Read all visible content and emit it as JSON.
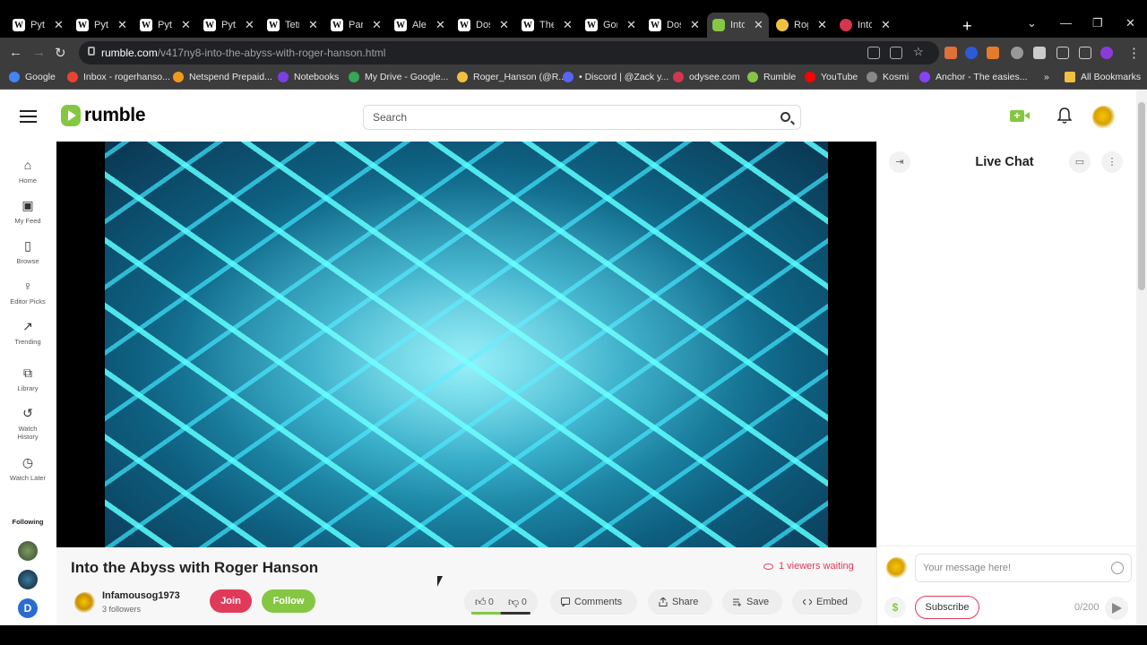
{
  "browser": {
    "tabs": [
      {
        "label": "Pyt",
        "fav": "W"
      },
      {
        "label": "Pyt",
        "fav": "W"
      },
      {
        "label": "Pyt",
        "fav": "W"
      },
      {
        "label": "Pyt",
        "fav": "W"
      },
      {
        "label": "Tetr",
        "fav": "W"
      },
      {
        "label": "Pan",
        "fav": "W"
      },
      {
        "label": "Alei",
        "fav": "W"
      },
      {
        "label": "Dos",
        "fav": "W"
      },
      {
        "label": "The",
        "fav": "W"
      },
      {
        "label": "Gor",
        "fav": "W"
      },
      {
        "label": "Dos",
        "fav": "W"
      },
      {
        "label": "Into",
        "fav": "rumble"
      },
      {
        "label": "Rog",
        "fav": "bulb"
      },
      {
        "label": "Into",
        "fav": "odysee"
      }
    ],
    "url_domain": "rumble.com",
    "url_path": "/v417ny8-into-the-abyss-with-roger-hanson.html",
    "bookmarks": [
      "Google",
      "Inbox - rogerhanso...",
      "Netspend Prepaid...",
      "Notebooks",
      "My Drive - Google...",
      "Roger_Hanson (@R...",
      "• Discord | @Zack y...",
      "odysee.com",
      "Rumble",
      "YouTube",
      "Kosmi",
      "Anchor - The easies..."
    ],
    "bookmarks_more": "»",
    "all_bookmarks": "All Bookmarks"
  },
  "header": {
    "logo_text": "rumble",
    "search_placeholder": "Search"
  },
  "sidebar": {
    "items": [
      {
        "label": "Home",
        "icon": "home-icon"
      },
      {
        "label": "My Feed",
        "icon": "feed-icon"
      },
      {
        "label": "Browse",
        "icon": "browse-icon"
      },
      {
        "label": "Editor Picks",
        "icon": "editor-picks-icon"
      },
      {
        "label": "Trending",
        "icon": "trending-icon"
      },
      {
        "label": "Library",
        "icon": "library-icon"
      },
      {
        "label": "Watch History",
        "icon": "history-icon"
      },
      {
        "label": "Watch Later",
        "icon": "clock-icon"
      }
    ],
    "following_label": "Following",
    "following_badge": "D"
  },
  "video": {
    "title": "Into the Abyss with Roger Hanson",
    "waiting": "1 viewers waiting",
    "channel_name": "Infamousog1973",
    "channel_followers": "3 followers",
    "join_label": "Join",
    "follow_label": "Follow",
    "likes": "0",
    "dislikes": "0",
    "vote_ratio": 0.5,
    "actions": {
      "comments": "Comments",
      "share": "Share",
      "save": "Save",
      "embed": "Embed"
    }
  },
  "chat": {
    "title": "Live Chat",
    "input_placeholder": "Your message here!",
    "subscribe_label": "Subscribe",
    "char_counter": "0/200"
  },
  "colors": {
    "brand_green": "#85c742",
    "accent_red": "#e03a5a"
  }
}
